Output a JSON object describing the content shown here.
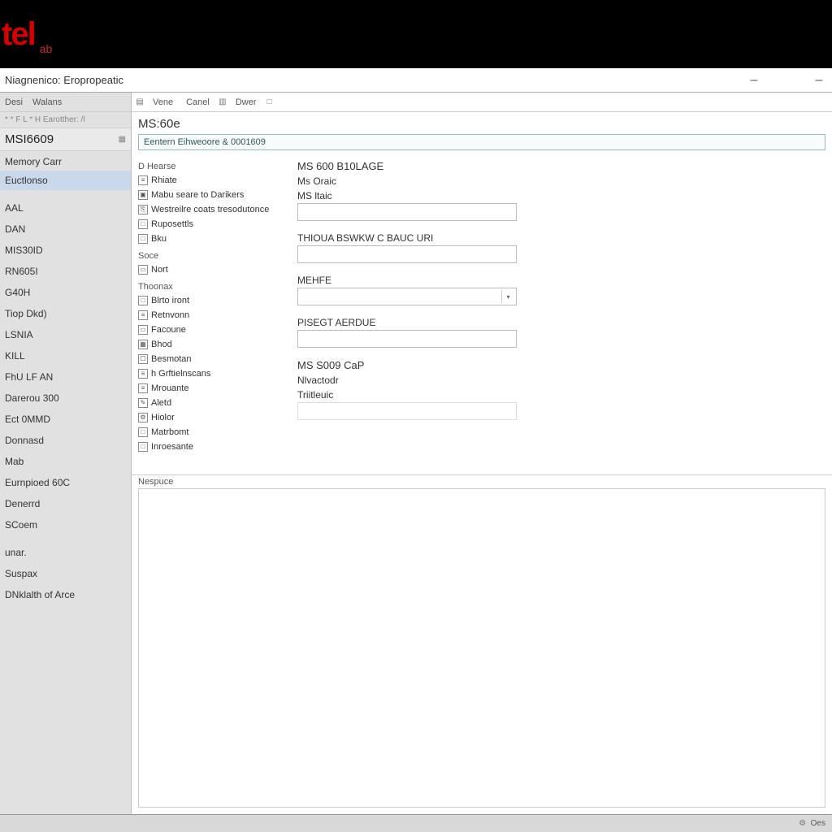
{
  "brand": {
    "logo": "tel",
    "sub": "ab"
  },
  "window": {
    "title": "Niagnenico: Eropropeatic"
  },
  "sidebar": {
    "menu": {
      "item0": "Desi",
      "item1": "Walans"
    },
    "symbols": "* * F L * H Earotther: /l",
    "title": "MSI6609",
    "cat0": "Memory Carr",
    "sel": "Euctlonso",
    "group1": [
      "AAL",
      "DAN",
      "MIS30ID",
      "RN605I",
      "G40H",
      "Tiop Dkd)",
      "LSNIA",
      "KILL",
      "FhU LF AN",
      "Darerou 300",
      "Ect 0MMD",
      "Donnasd",
      "Mab",
      "Eurnpioed 60C",
      "Denerrd",
      "SCoem"
    ],
    "group2": [
      "unar.",
      "Suspax",
      "DNklalth of Arce"
    ]
  },
  "toolbar": {
    "btn0": "Vene",
    "btn1": "Canel",
    "btn2": "Dwer"
  },
  "page": {
    "title": "MS:60e",
    "subheader": "Eentern Eihweoore & 0001609"
  },
  "props": {
    "h0": "D Hearse",
    "items0": [
      "Rhiate",
      "Mabu seare to Darikers",
      "Westreilre coats tresodutonce",
      "Ruposettls",
      "Bku"
    ],
    "h1": "Soce",
    "items1": [
      "Nort"
    ],
    "h2": "Thoonax",
    "items2": [
      "Blrto iront",
      "Retnvonn",
      "Facoune",
      "Bhod",
      "Besmotan",
      "h Grftielnscans",
      "Mrouante",
      "Aletd",
      "Hiolor",
      "Matrbomt",
      "Inroesante"
    ]
  },
  "form": {
    "l0": "MS 600 B10LAGE",
    "v0a": "Ms Oraic",
    "v0b": "MS ltaic",
    "l1": "THIOUA BSWKW C BAUC URI",
    "l2": "MEHFE",
    "l3": "PISEGT AERDUE",
    "l4": "MS S009 CaP",
    "v4a": "Nlvactodr",
    "v4b": "Triitleuic"
  },
  "notes_h": "Nespuce",
  "status": "Oes"
}
